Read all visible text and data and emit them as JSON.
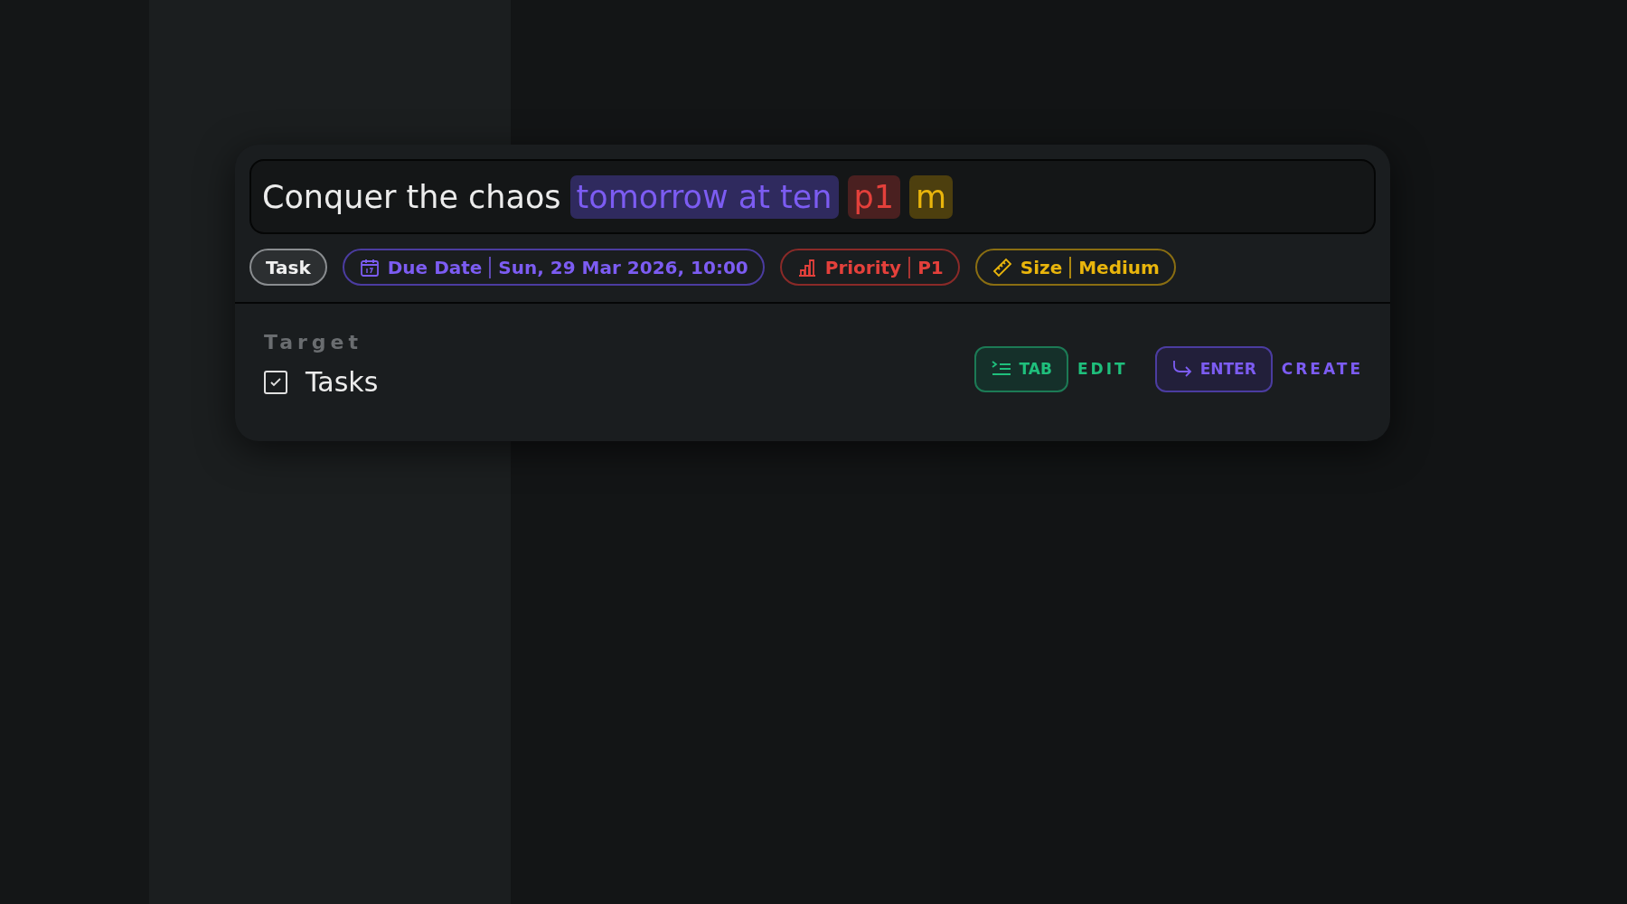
{
  "input": {
    "tokens": [
      {
        "kind": "text",
        "text": "Conquer the chaos"
      },
      {
        "kind": "date",
        "text": "tomorrow at ten"
      },
      {
        "kind": "priority",
        "text": "p1"
      },
      {
        "kind": "size",
        "text": "m"
      }
    ]
  },
  "chips": [
    {
      "kind": "type",
      "label": "Task"
    },
    {
      "kind": "date",
      "label": "Due Date",
      "value": "Sun, 29 Mar 2026, 10:00"
    },
    {
      "kind": "priority",
      "label": "Priority",
      "value": "P1"
    },
    {
      "kind": "size",
      "label": "Size",
      "value": "Medium"
    }
  ],
  "target": {
    "heading": "Target",
    "options": [
      {
        "label": "Tasks",
        "checked": true
      }
    ]
  },
  "actions": [
    {
      "kind": "edit",
      "key": "TAB",
      "label": "EDIT"
    },
    {
      "kind": "create",
      "key": "ENTER",
      "label": "CREATE"
    }
  ]
}
